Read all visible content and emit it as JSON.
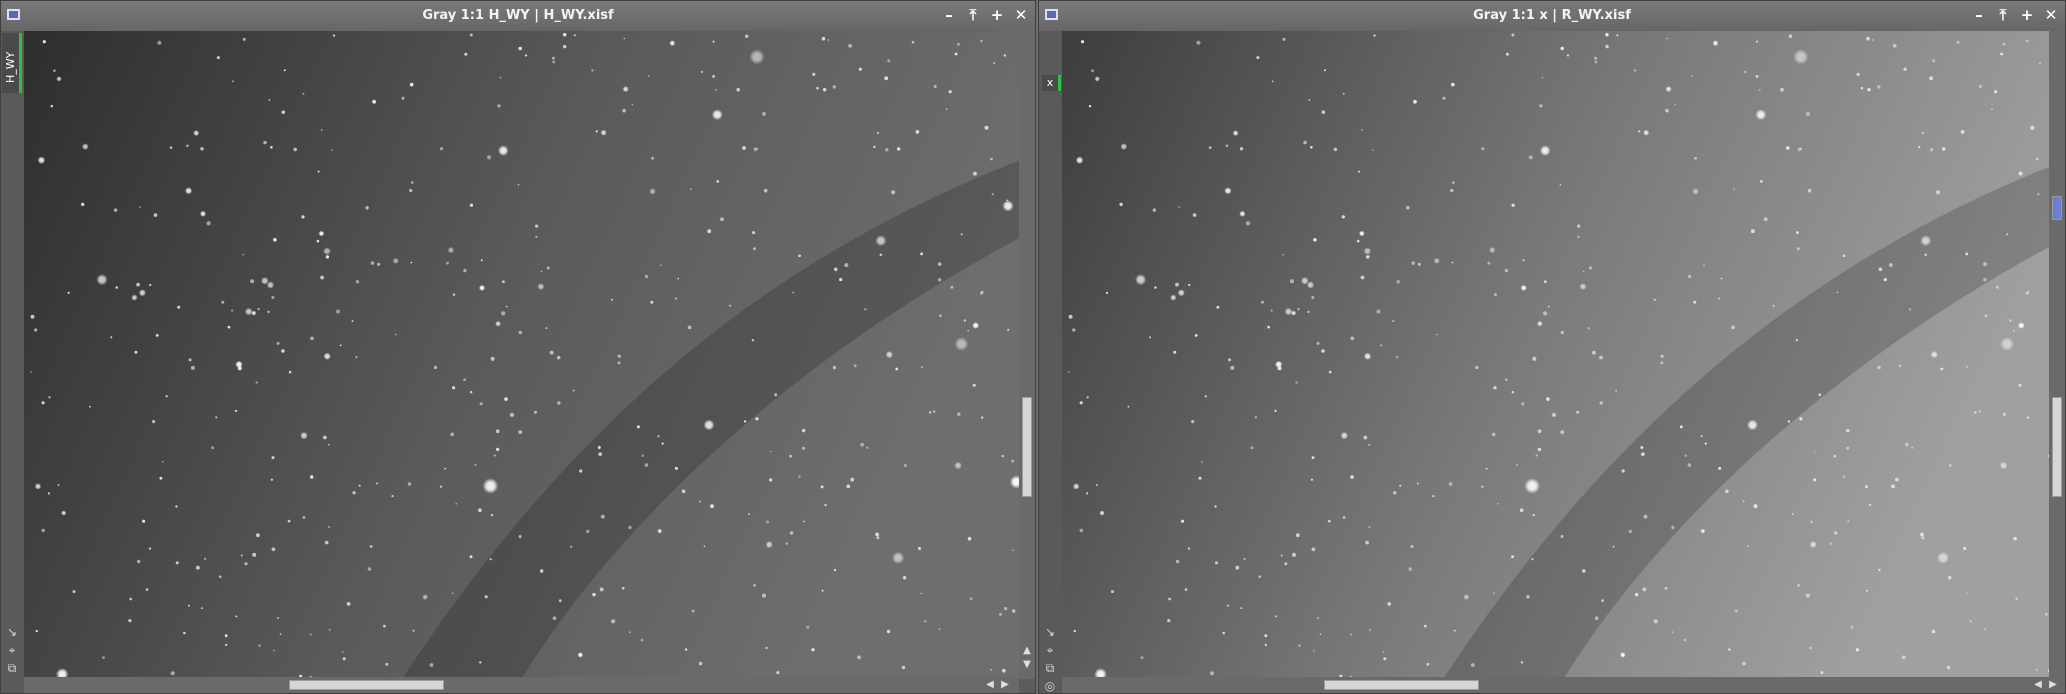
{
  "windows": {
    "left": {
      "title": "Gray 1:1 H_WY | H_WY.xisf",
      "side_tab": "H_WY",
      "buttons": {
        "minimize": "–",
        "shade": "⤒",
        "maximize": "+",
        "close": "✕"
      }
    },
    "right": {
      "title": "Gray 1:1 x | R_WY.xisf",
      "side_tab": "x",
      "buttons": {
        "minimize": "–",
        "shade": "⤒",
        "maximize": "+",
        "close": "✕"
      }
    }
  },
  "sidebar_tools": {
    "tool1": "↘",
    "tool2": "⌖",
    "tool3": "⧉",
    "tool4": "◎"
  },
  "scroll_arrows": {
    "up": "▲",
    "down": "▼",
    "left": "◀",
    "right": "▶"
  },
  "colors": {
    "accent_tab": "#2dbf4a",
    "titlebar": "#6e6e6e",
    "viewport_bg": "#3a3a3a"
  },
  "scroll": {
    "left": {
      "vertical_position": 0.49,
      "horizontal_position": 0.2
    },
    "right": {
      "vertical_position": 0.49,
      "horizontal_position": 0.2
    }
  }
}
